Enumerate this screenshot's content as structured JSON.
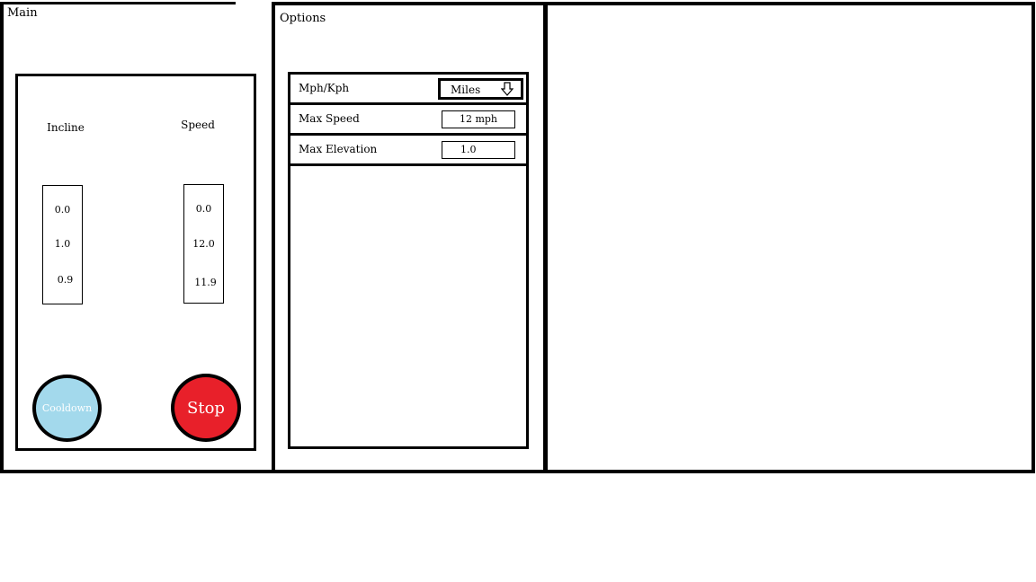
{
  "main": {
    "title": "Main",
    "incline": {
      "label": "Incline",
      "values": [
        "0.0",
        "1.0",
        "0.9"
      ]
    },
    "speed": {
      "label": "Speed",
      "values": [
        "0.0",
        "12.0",
        "11.9"
      ]
    },
    "cooldown_label": "Cooldown",
    "stop_label": "Stop",
    "colors": {
      "cooldown": "#a3d9ec",
      "stop": "#e8202a"
    }
  },
  "options": {
    "title": "Options",
    "units": {
      "label": "Mph/Kph",
      "value": "Miles",
      "icon": "down-arrow-icon"
    },
    "max_speed": {
      "label": "Max Speed",
      "value": "12 mph"
    },
    "max_elevation": {
      "label": "Max Elevation",
      "value": "1.0"
    }
  }
}
